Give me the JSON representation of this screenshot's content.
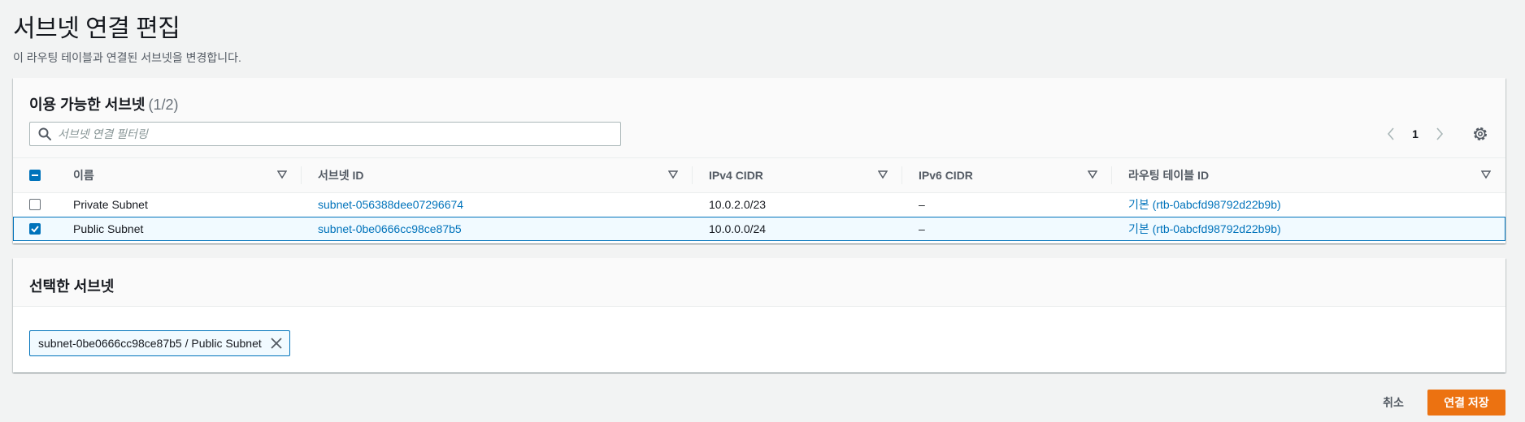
{
  "page": {
    "title": "서브넷 연결 편집",
    "description": "이 라우팅 테이블과 연결된 서브넷을 변경합니다."
  },
  "available": {
    "title": "이용 가능한 서브넷",
    "count": "(1/2)",
    "filter_placeholder": "서브넷 연결 필터링",
    "page_number": "1",
    "columns": [
      "이름",
      "서브넷 ID",
      "IPv4 CIDR",
      "IPv6 CIDR",
      "라우팅 테이블 ID"
    ],
    "rows": [
      {
        "name": "Private Subnet",
        "subnet_id": "subnet-056388dee07296674",
        "ipv4": "10.0.2.0/23",
        "ipv6": "–",
        "route_table": "기본 (rtb-0abcfd98792d22b9b)",
        "checked": false
      },
      {
        "name": "Public Subnet",
        "subnet_id": "subnet-0be0666cc98ce87b5",
        "ipv4": "10.0.0.0/24",
        "ipv6": "–",
        "route_table": "기본 (rtb-0abcfd98792d22b9b)",
        "checked": true
      }
    ]
  },
  "selected": {
    "title": "선택한 서브넷",
    "token_label": "subnet-0be0666cc98ce87b5 / Public Subnet"
  },
  "actions": {
    "cancel_label": "취소",
    "save_label": "연결 저장"
  },
  "icons": {
    "search": "search-icon",
    "prev": "chevron-left-icon",
    "next": "chevron-right-icon",
    "settings": "gear-icon",
    "sort": "caret-down-icon",
    "remove": "close-icon"
  },
  "colors": {
    "link": "#0073bb",
    "primary_button": "#ec7211",
    "selected_row_bg": "#f1faff"
  }
}
